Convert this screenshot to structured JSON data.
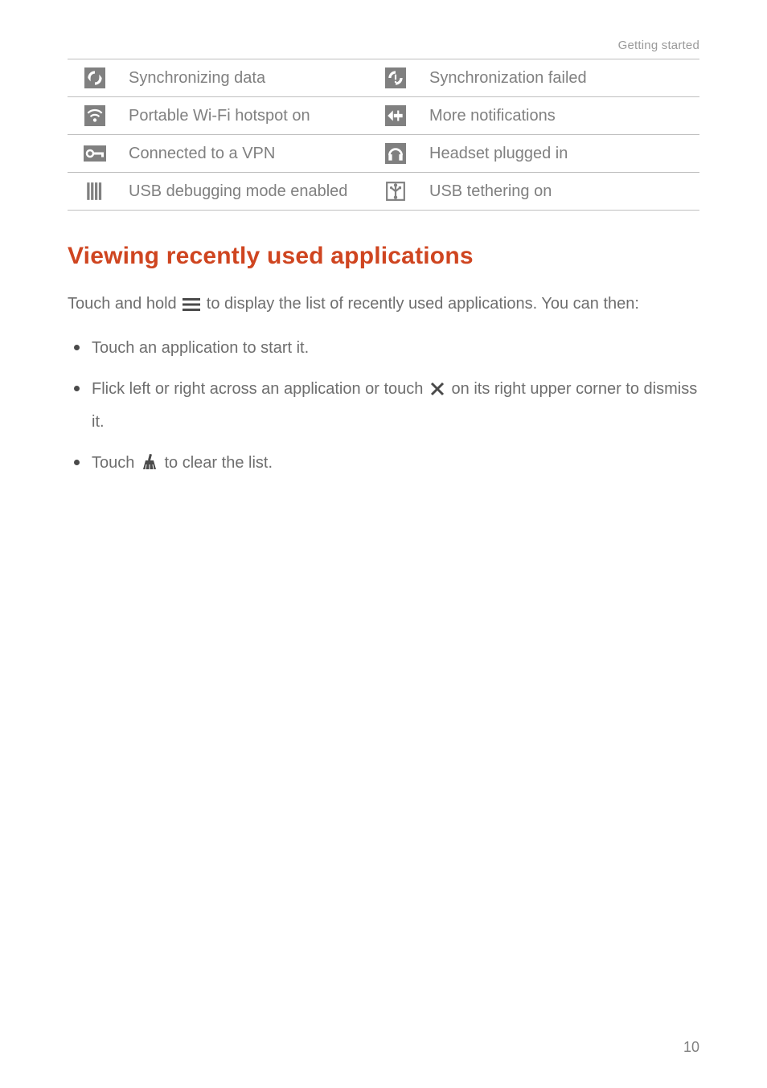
{
  "header_small": "Getting started",
  "table_rows": [
    {
      "desc1": "Synchronizing data",
      "desc2": "Synchronization failed"
    },
    {
      "desc1": "Portable Wi-Fi hotspot on",
      "desc2": "More notifications"
    },
    {
      "desc1": "Connected to a VPN",
      "desc2": "Headset plugged in"
    },
    {
      "desc1": "USB debugging mode enabled",
      "desc2": "USB tethering on"
    }
  ],
  "section_heading": "Viewing recently used applications",
  "paragraph_parts": {
    "before_icon": "Touch and hold ",
    "after_icon": " to display the list of recently used applications. You can then:"
  },
  "bullets": [
    {
      "type": "plain",
      "text": "Touch an application to start it."
    },
    {
      "type": "split",
      "before": "Flick left or right across an application or touch ",
      "after": " on its right upper corner to dismiss it."
    },
    {
      "type": "split",
      "before": "Touch ",
      "after": " to clear the list."
    }
  ],
  "page_number": "10"
}
